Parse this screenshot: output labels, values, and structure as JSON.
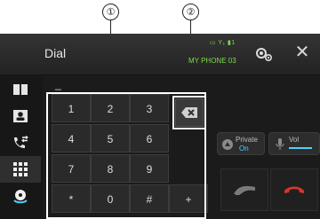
{
  "annotations": {
    "callout_1": "①",
    "callout_2": "②"
  },
  "header": {
    "title": "Dial",
    "status_icons": "▭ Y₁ ▮1",
    "device": "MY PHONE 03"
  },
  "sidebar": {
    "items": [
      {
        "icon": "book-icon"
      },
      {
        "icon": "contacts-icon"
      },
      {
        "icon": "call-history-icon"
      },
      {
        "icon": "keypad-icon"
      },
      {
        "icon": "voice-dial-icon"
      }
    ]
  },
  "display": {
    "number": "_"
  },
  "keypad": {
    "keys": [
      {
        "label": "1"
      },
      {
        "label": "2"
      },
      {
        "label": "3"
      },
      {
        "label": "4"
      },
      {
        "label": "5"
      },
      {
        "label": "6"
      },
      {
        "label": "7"
      },
      {
        "label": "8"
      },
      {
        "label": "9"
      },
      {
        "label": "*"
      },
      {
        "label": "0"
      },
      {
        "label": "#"
      },
      {
        "label": "+"
      }
    ]
  },
  "controls": {
    "private_label": "Private",
    "private_state": "On",
    "vol_label": "Vol",
    "colors": {
      "status_green": "#7edc4c",
      "accent_blue": "#4fd0ff",
      "hangup_red": "#d8352b"
    }
  }
}
